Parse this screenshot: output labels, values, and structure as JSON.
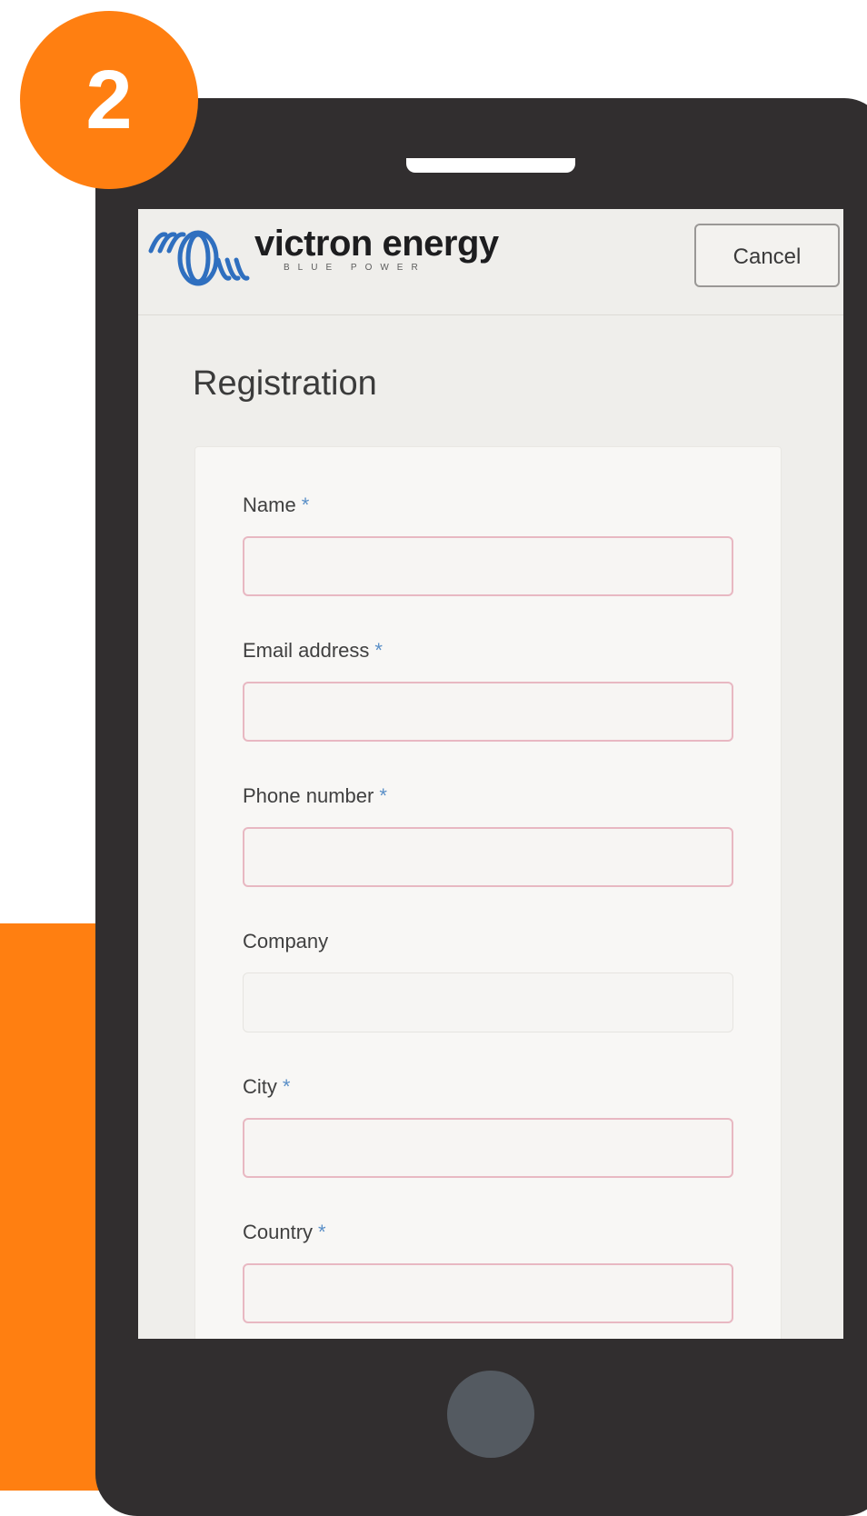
{
  "step": {
    "number": "2"
  },
  "header": {
    "logo_text": "victron energy",
    "logo_tagline": "BLUE POWER",
    "cancel_label": "Cancel"
  },
  "page": {
    "title": "Registration"
  },
  "form": {
    "required_marker": "*",
    "fields": [
      {
        "label": "Name",
        "required": true,
        "value": ""
      },
      {
        "label": "Email address",
        "required": true,
        "value": ""
      },
      {
        "label": "Phone number",
        "required": true,
        "value": ""
      },
      {
        "label": "Company",
        "required": false,
        "value": ""
      },
      {
        "label": "City",
        "required": true,
        "value": ""
      },
      {
        "label": "Country",
        "required": true,
        "value": ""
      }
    ]
  },
  "colors": {
    "accent_orange": "#ff7f11",
    "phone_body": "#312e2f",
    "logo_blue": "#2f6fbf",
    "required_star": "#5a8fc7",
    "invalid_border": "#e8b8c2"
  },
  "icons": {
    "logo": "victron-spiral-logo-icon",
    "home": "home-button-icon"
  }
}
